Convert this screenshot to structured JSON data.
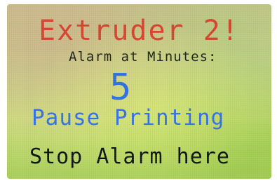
{
  "screen": {
    "title": "Extruder 2!",
    "subtitle": "Alarm at Minutes:",
    "minutes_value": "5",
    "pause_label": "Pause Printing",
    "stop_label": "Stop Alarm here"
  },
  "colors": {
    "title": "#d6432f",
    "accent": "#3570e6",
    "text": "#0d1510"
  }
}
